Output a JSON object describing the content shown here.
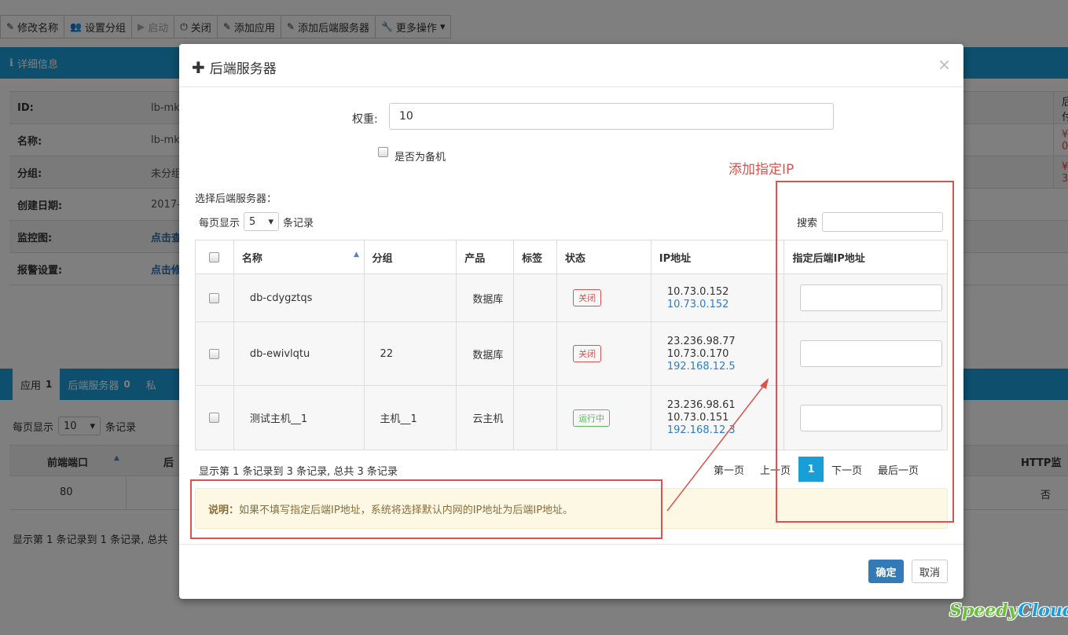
{
  "toolbar": {
    "rename": "修改名称",
    "set_group": "设置分组",
    "start": "启动",
    "close": "关闭",
    "add_app": "添加应用",
    "add_backend": "添加后端服务器",
    "more": "更多操作"
  },
  "details": {
    "header": "详细信息",
    "rows": [
      {
        "label": "ID:",
        "value": "lb-mk",
        "right": "后付"
      },
      {
        "label": "名称:",
        "value": "lb-mk",
        "right": "¥ 0"
      },
      {
        "label": "分组:",
        "value": "未分组",
        "right": "¥ 3"
      },
      {
        "label": "创建日期:",
        "value": "2017-",
        "right": ""
      },
      {
        "label": "监控图:",
        "value": "点击查",
        "right": ""
      },
      {
        "label": "报警设置:",
        "value": "点击修",
        "right": ""
      }
    ]
  },
  "tabs": [
    {
      "label": "应用",
      "count": "1"
    },
    {
      "label": "后端服务器",
      "count": "0"
    },
    {
      "label": "私",
      "count": ""
    }
  ],
  "listing": {
    "per_page_label": "每页显示",
    "per_page_value": "10",
    "records_label": "条记录",
    "col_frontend_port": "前端端口",
    "col_backend": "后",
    "col_http": "HTTP监",
    "row_port": "80",
    "row_http": "否",
    "footer": "显示第 1 条记录到 1 条记录, 总共"
  },
  "modal": {
    "title": "后端服务器",
    "weight_label": "权重:",
    "weight_value": "10",
    "backup_label": "是否为备机",
    "annotation": "添加指定IP",
    "select_label": "选择后端服务器：",
    "per_page_label": "每页显示",
    "per_page_value": "5",
    "records_label": "条记录",
    "search_label": "搜索",
    "columns": [
      "名称",
      "分组",
      "产品",
      "标签",
      "状态",
      "IP地址",
      "指定后端IP地址"
    ],
    "rows": [
      {
        "name": "db-cdygztqs",
        "group": "",
        "product": "数据库",
        "tag": "",
        "status": "关闭",
        "ips": [
          "10.73.0.152"
        ],
        "ip_link": "10.73.0.152"
      },
      {
        "name": "db-ewivlqtu",
        "group": "22",
        "product": "数据库",
        "tag": "",
        "status": "关闭",
        "ips": [
          "23.236.98.77",
          "10.73.0.170"
        ],
        "ip_link": "192.168.12.5"
      },
      {
        "name": "测试主机__1",
        "group": "主机__1",
        "product": "云主机",
        "tag": "",
        "status": "运行中",
        "ips": [
          "23.236.98.61",
          "10.73.0.151"
        ],
        "ip_link": "192.168.12.3"
      }
    ],
    "summary": "显示第 1 条记录到 3 条记录, 总共 3 条记录",
    "pager": {
      "first": "第一页",
      "prev": "上一页",
      "current": "1",
      "next": "下一页",
      "last": "最后一页"
    },
    "note_bold": "说明：",
    "note_text": "如果不填写指定后端IP地址，系统将选择默认内网的IP地址为后端IP地址。",
    "ok": "确定",
    "cancel": "取消",
    "close_glyph": "×"
  },
  "logo": {
    "part1": "Speedy",
    "part2": "Cloud",
    "mark": "®"
  }
}
